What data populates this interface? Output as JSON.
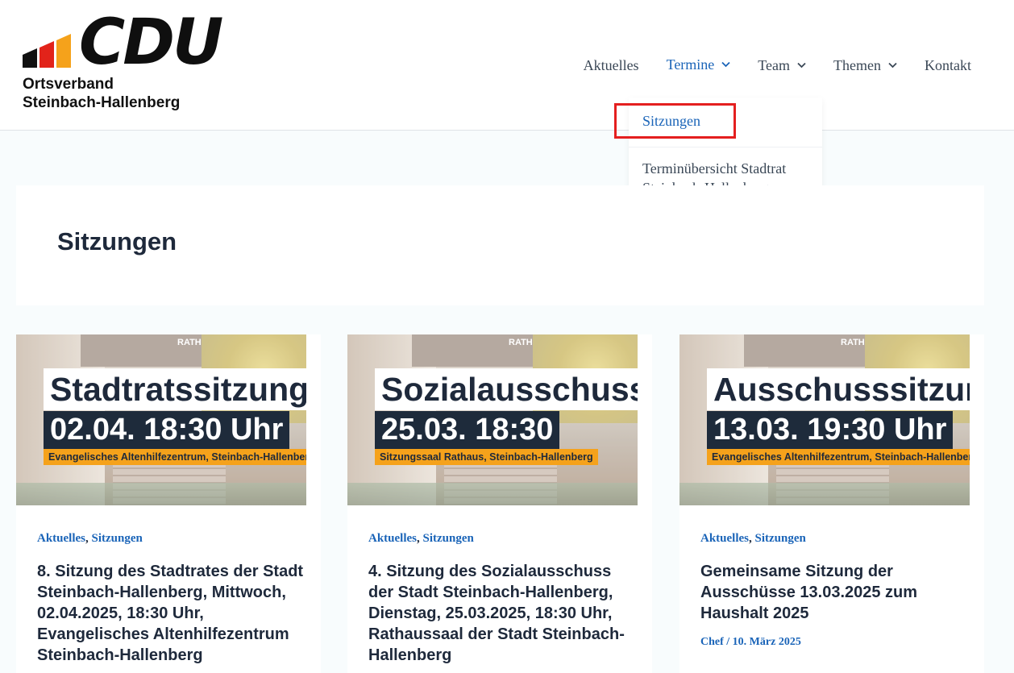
{
  "brand": {
    "logo_text": "CDU",
    "subtitle_line1": "Ortsverband",
    "subtitle_line2": "Steinbach-Hallenberg",
    "colors": {
      "bar_black": "#111111",
      "bar_red": "#e2231a",
      "bar_gold": "#f5a21b"
    }
  },
  "nav": {
    "items": [
      {
        "label": "Aktuelles",
        "has_dropdown": false
      },
      {
        "label": "Termine",
        "has_dropdown": true,
        "active": true
      },
      {
        "label": "Team",
        "has_dropdown": true
      },
      {
        "label": "Themen",
        "has_dropdown": true
      },
      {
        "label": "Kontakt",
        "has_dropdown": false
      }
    ],
    "dropdown": [
      {
        "label": "Sitzungen",
        "active": true
      },
      {
        "label": "Terminübersicht Stadtrat Steinbach-Hallenberg"
      }
    ]
  },
  "page": {
    "title": "Sitzungen"
  },
  "posts": [
    {
      "image": {
        "overlay_title": "Stadtratssitzung",
        "overlay_date": "02.04. 18:30 Uhr",
        "overlay_location": "Evangelisches Altenhilfezentrum, Steinbach-Hallenberg",
        "roof_sign": "RATHAUS"
      },
      "categories": [
        "Aktuelles",
        "Sitzungen"
      ],
      "category_separator": ",",
      "title": "8. Sitzung des Stadtrates der Stadt Steinbach-Hallenberg, Mittwoch, 02.04.2025, 18:30 Uhr, Evangelisches Altenhilfezentrum Steinbach-Hallenberg"
    },
    {
      "image": {
        "overlay_title": "Sozialausschuss",
        "overlay_date": "25.03. 18:30",
        "overlay_location": "Sitzungssaal Rathaus, Steinbach-Hallenberg",
        "roof_sign": "RATHAUS"
      },
      "categories": [
        "Aktuelles",
        "Sitzungen"
      ],
      "category_separator": ",",
      "title": "4. Sitzung des Sozialausschuss der Stadt Steinbach-Hallenberg, Dienstag, 25.03.2025, 18:30 Uhr, Rathaussaal der Stadt Steinbach-Hallenberg"
    },
    {
      "image": {
        "overlay_title": "Ausschusssitzung",
        "overlay_date": "13.03. 19:30 Uhr",
        "overlay_location": "Evangelisches Altenhilfezentrum, Steinbach-Hallenberg",
        "roof_sign": "RATHAUS"
      },
      "categories": [
        "Aktuelles",
        "Sitzungen"
      ],
      "category_separator": ",",
      "title": "Gemeinsame Sitzung der Ausschüsse 13.03.2025 zum Haushalt 2025",
      "meta_author": "Chef",
      "meta_separator": " / ",
      "meta_date": "10. März 2025"
    }
  ]
}
